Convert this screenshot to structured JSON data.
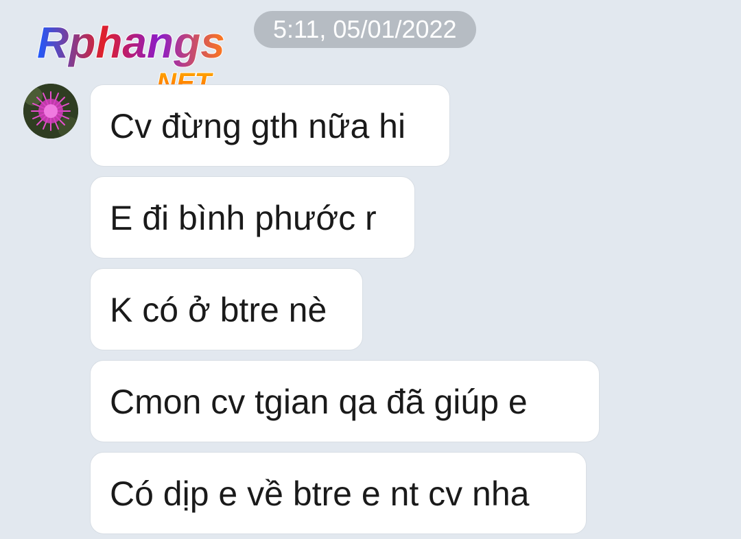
{
  "timestamp": "5:11, 05/01/2022",
  "watermark": {
    "main": "Rphangs",
    "sub": ".NET"
  },
  "avatar": {
    "icon": "pink-flower-avatar"
  },
  "messages": [
    "Cv đừng gth nữa hi",
    "E đi bình phước r",
    "K có ở btre nè",
    "Cmon cv tgian qa đã giúp e",
    "Có dịp e về btre e nt cv nha"
  ],
  "colors": {
    "background": "#e2e8ef",
    "bubble": "#ffffff",
    "timestamp_pill": "#b6bcc3",
    "text": "#1a1a1a"
  }
}
